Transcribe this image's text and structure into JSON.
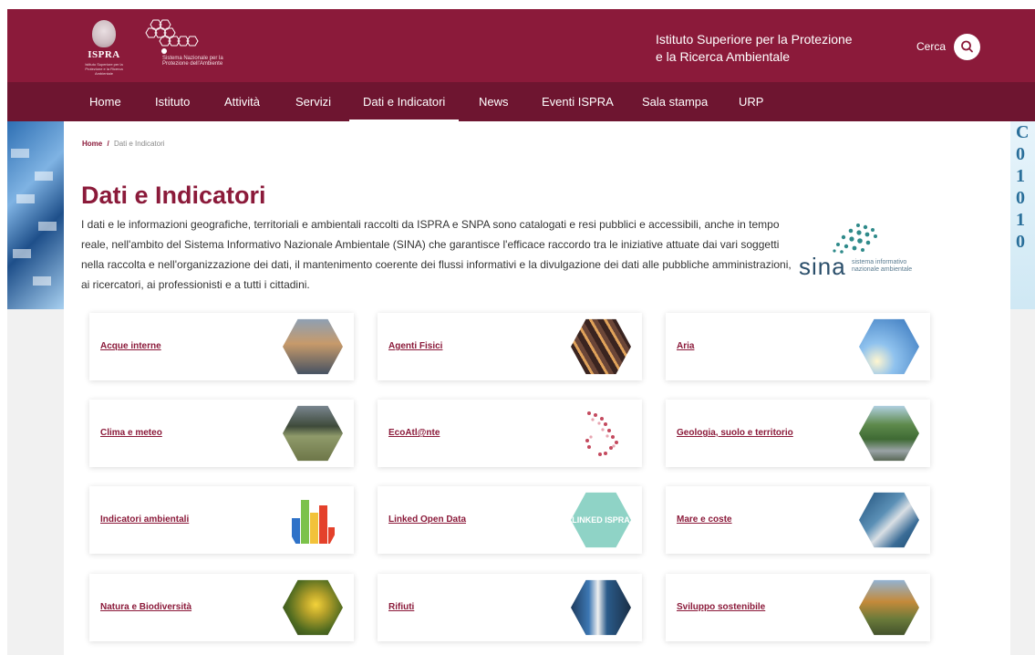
{
  "header": {
    "logo_name": "ISPRA",
    "logo_subtitle": "Istituto Superiore per la Protezione e la Ricerca Ambientale",
    "snpa_text": "Sistema Nazionale per la Protezione dell'Ambiente",
    "institute_line1": "Istituto Superiore per la Protezione",
    "institute_line2": "e la Ricerca Ambientale",
    "search_label": "Cerca",
    "colors": {
      "brand": "#8b1a3a",
      "nav": "#6e1530"
    }
  },
  "nav": {
    "items": [
      {
        "label": "Home"
      },
      {
        "label": "Istituto"
      },
      {
        "label": "Attività"
      },
      {
        "label": "Servizi"
      },
      {
        "label": "Dati e Indicatori",
        "active": true
      },
      {
        "label": "News"
      },
      {
        "label": "Eventi ISPRA"
      },
      {
        "label": "Sala stampa"
      },
      {
        "label": "URP"
      }
    ]
  },
  "breadcrumb": {
    "home": "Home",
    "separator": "/",
    "current": "Dati e Indicatori"
  },
  "page": {
    "title": "Dati e Indicatori",
    "intro": "I dati e le informazioni geografiche, territoriali e ambientali raccolti da ISPRA e SNPA sono catalogati e resi pubblici e accessibili, anche in tempo reale, nell'ambito del Sistema Informativo Nazionale Ambientale (SINA) che garantisce l'efficace raccordo tra le iniziative attuate dai vari soggetti nella raccolta e nell'organizzazione dei dati, il mantenimento coerente dei flussi informativi e la divulgazione dei dati alle pubbliche amministrazioni, ai ricercatori, ai professionisti e a tutti i cittadini."
  },
  "sina": {
    "word": "sina",
    "sub1": "sistema informativo",
    "sub2": "nazionale ambientale"
  },
  "side_right_chars": [
    "C",
    "0",
    "1",
    "0",
    "1",
    "0"
  ],
  "cards": [
    {
      "label": "Acque interne",
      "image": "river-at-sunset",
      "hex_color": "#5b6e86"
    },
    {
      "label": "Agenti Fisici",
      "image": "traffic-light-trails",
      "hex_color": "#5a3a34"
    },
    {
      "label": "Aria",
      "image": "blue-sky",
      "hex_color": "#4f8fd0"
    },
    {
      "label": "Clima e meteo",
      "image": "mountain-field",
      "hex_color": "#6b7a52"
    },
    {
      "label": "EcoAtl@nte",
      "image": "italy-map-dots",
      "hex_color": "#d9b0b8"
    },
    {
      "label": "Geologia, suolo e territorio",
      "image": "mountain-village",
      "hex_color": "#5e7c4c"
    },
    {
      "label": "Indicatori ambientali",
      "image": "bar-chart",
      "hex_color": "#ffffff"
    },
    {
      "label": "Linked Open Data",
      "image": "linked-ispra-logo",
      "hex_color": "#86cfc2",
      "image_text": "LINKED ISPRA"
    },
    {
      "label": "Mare e coste",
      "image": "coast-aerial",
      "hex_color": "#3c6f93"
    },
    {
      "label": "Natura e Biodiversità",
      "image": "yellow-flower",
      "hex_color": "#6a8a2a"
    },
    {
      "label": "Rifiuti",
      "image": "recycling-bins",
      "hex_color": "#2f5b85"
    },
    {
      "label": "Sviluppo sostenibile",
      "image": "autumn-valley",
      "hex_color": "#8a6a3a"
    }
  ]
}
